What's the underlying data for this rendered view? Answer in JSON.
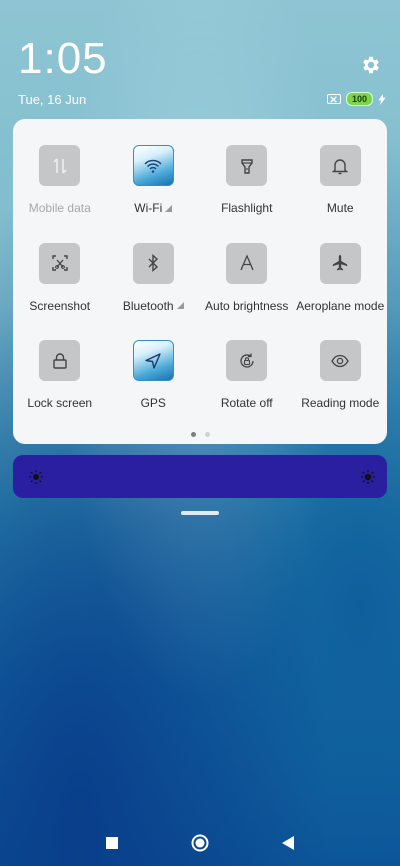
{
  "header": {
    "time": "1:05",
    "date": "Tue, 16 Jun",
    "battery_level": "100"
  },
  "tiles": [
    {
      "label": "Mobile data",
      "icon": "mobile-data-icon",
      "state": "disabled"
    },
    {
      "label": "Wi-Fi",
      "icon": "wifi-icon",
      "state": "on",
      "has_expand": true
    },
    {
      "label": "Flashlight",
      "icon": "flashlight-icon",
      "state": "off"
    },
    {
      "label": "Mute",
      "icon": "bell-icon",
      "state": "off"
    },
    {
      "label": "Screenshot",
      "icon": "screenshot-icon",
      "state": "off"
    },
    {
      "label": "Bluetooth",
      "icon": "bluetooth-icon",
      "state": "off",
      "has_expand": true
    },
    {
      "label": "Auto brightness",
      "icon": "auto-brightness-icon",
      "state": "off"
    },
    {
      "label": "Aeroplane mode",
      "icon": "airplane-icon",
      "state": "off"
    },
    {
      "label": "Lock screen",
      "icon": "lock-icon",
      "state": "off"
    },
    {
      "label": "GPS",
      "icon": "location-arrow-icon",
      "state": "on"
    },
    {
      "label": "Rotate off",
      "icon": "rotate-lock-icon",
      "state": "off"
    },
    {
      "label": "Reading mode",
      "icon": "eye-icon",
      "state": "off"
    }
  ],
  "pager": {
    "pages": 2,
    "current": 1
  },
  "brightness": {
    "level_fraction": 1.0
  },
  "colors": {
    "panel": "#f4f6f7",
    "tile_off": "#c4c6c8",
    "tile_on": "#3a8cc3",
    "brightness_bar": "#2a1fa0",
    "battery": "#7bd64a"
  }
}
